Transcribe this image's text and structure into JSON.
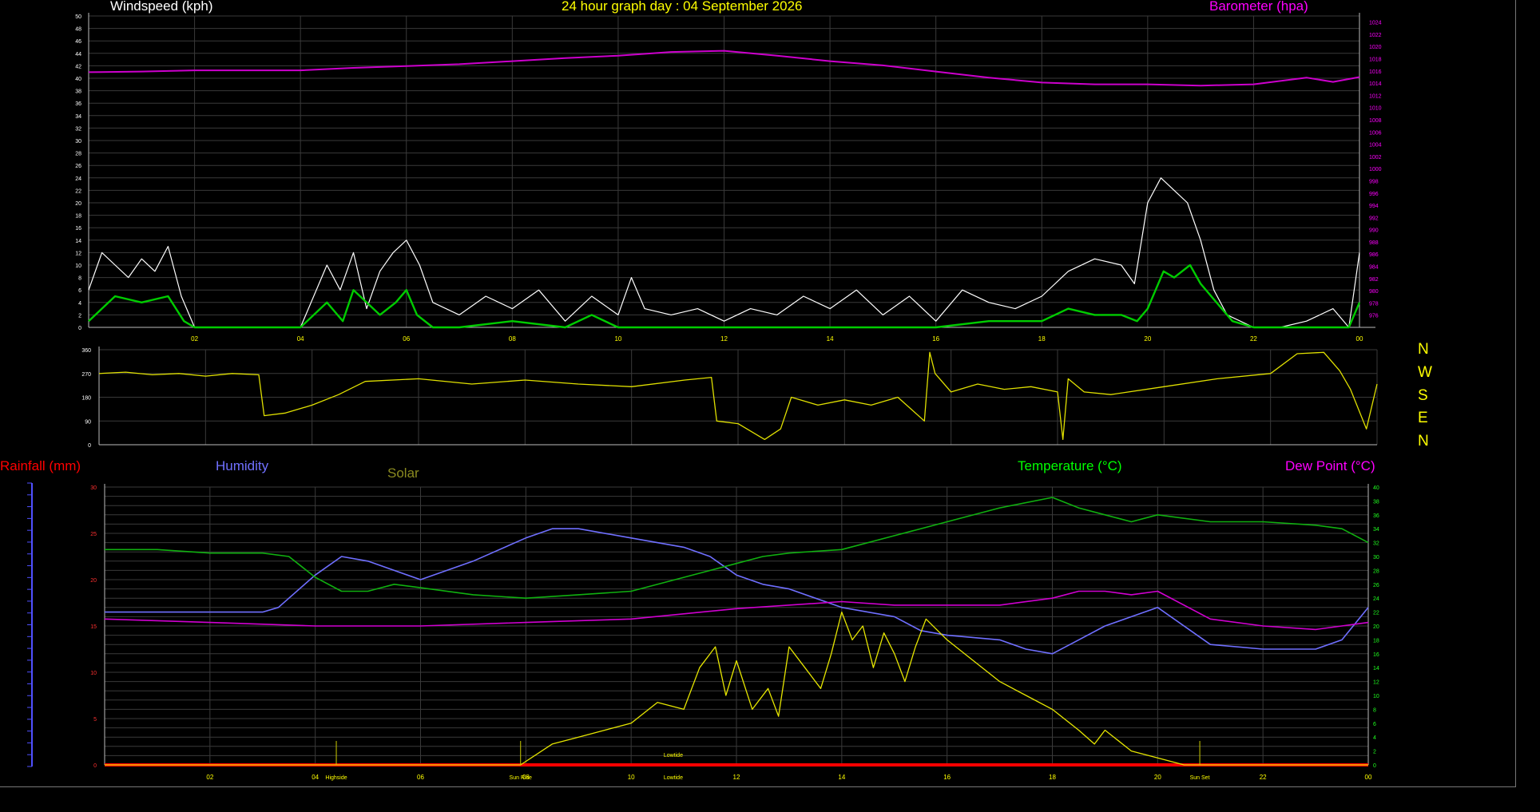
{
  "header": {
    "windspeed_title": "Windspeed (kph)",
    "main_title": "24 hour graph day : 04 September 2026",
    "barometer_title": "Barometer (hpa)"
  },
  "lower_header": {
    "rainfall_title": "Rainfall (mm)",
    "humidity_title": "Humidity",
    "solar_title": "Solar",
    "temperature_title": "Temperature (°C)",
    "dewpoint_title": "Dew Point (°C)"
  },
  "compass_labels": [
    "N",
    "W",
    "S",
    "E",
    "N"
  ],
  "colors": {
    "windspeed": "#ffffff",
    "wind_avg": "#00cc00",
    "barometer": "#cc00cc",
    "wind_direction": "#e0e000",
    "humidity": "#6f6fff",
    "temperature": "#10b010",
    "dewpoint": "#d000d0",
    "solar": "#e6e600",
    "rainfall": "#ff0000",
    "grid": "#3a3a3a"
  },
  "chart_data": [
    {
      "type": "line",
      "title": "24 hour graph day : 04 September 2026",
      "x_tick_labels": [
        "02",
        "04",
        "06",
        "08",
        "10",
        "12",
        "14",
        "16",
        "18",
        "20",
        "22",
        "00"
      ],
      "x_range_hours": [
        0.0,
        24.0
      ],
      "ylabel": "Windspeed (kph)",
      "ylim": [
        0,
        50
      ],
      "y_ticks": [
        0,
        2,
        4,
        6,
        8,
        10,
        12,
        14,
        16,
        18,
        20,
        22,
        24,
        26,
        28,
        30,
        32,
        34,
        36,
        38,
        40,
        42,
        44,
        46,
        48,
        50
      ],
      "y2label": "Barometer (hpa)",
      "y2lim": [
        974,
        1025
      ],
      "y2_ticks": [
        976,
        978,
        980,
        982,
        984,
        986,
        988,
        990,
        992,
        994,
        996,
        998,
        1000,
        1002,
        1004,
        1006,
        1008,
        1010,
        1012,
        1014,
        1016,
        1018,
        1020,
        1022,
        1024
      ],
      "series": [
        {
          "name": "Windspeed (kph)",
          "axis": "left",
          "x": [
            0.0,
            0.25,
            0.5,
            0.75,
            1.0,
            1.25,
            1.5,
            1.75,
            2.0,
            3.0,
            4.0,
            4.5,
            4.75,
            5.0,
            5.25,
            5.5,
            5.75,
            6.0,
            6.25,
            6.5,
            7.0,
            7.5,
            8.0,
            8.5,
            9.0,
            9.5,
            10.0,
            10.25,
            10.5,
            11.0,
            11.5,
            12.0,
            12.5,
            13.0,
            13.5,
            14.0,
            14.5,
            15.0,
            15.5,
            16.0,
            16.5,
            17.0,
            17.5,
            18.0,
            18.5,
            19.0,
            19.5,
            19.75,
            20.0,
            20.25,
            20.5,
            20.75,
            21.0,
            21.25,
            21.5,
            22.0,
            22.5,
            23.0,
            23.5,
            23.8,
            24.0
          ],
          "y": [
            6,
            12,
            10,
            8,
            11,
            9,
            13,
            5,
            0,
            0,
            0,
            10,
            6,
            12,
            3,
            9,
            12,
            14,
            10,
            4,
            2,
            5,
            3,
            6,
            1,
            5,
            2,
            8,
            3,
            2,
            3,
            1,
            3,
            2,
            5,
            3,
            6,
            2,
            5,
            1,
            6,
            4,
            3,
            5,
            9,
            11,
            10,
            7,
            20,
            24,
            22,
            20,
            14,
            6,
            2,
            0,
            0,
            1,
            3,
            0,
            12
          ]
        },
        {
          "name": "Windspeed average (kph)",
          "axis": "left",
          "x": [
            0.0,
            0.5,
            1.0,
            1.5,
            1.8,
            2.0,
            3.0,
            4.0,
            4.5,
            4.8,
            5.0,
            5.5,
            5.8,
            6.0,
            6.2,
            6.5,
            7.0,
            8.0,
            9.0,
            9.5,
            10.0,
            12.0,
            14.0,
            16.0,
            17.0,
            18.0,
            18.5,
            19.0,
            19.5,
            19.8,
            20.0,
            20.3,
            20.5,
            20.8,
            21.0,
            21.3,
            21.6,
            22.0,
            23.0,
            23.8,
            24.0
          ],
          "y": [
            1,
            5,
            4,
            5,
            1,
            0,
            0,
            0,
            4,
            1,
            6,
            2,
            4,
            6,
            2,
            0,
            0,
            1,
            0,
            2,
            0,
            0,
            0,
            0,
            1,
            1,
            3,
            2,
            2,
            1,
            3,
            9,
            8,
            10,
            7,
            4,
            1,
            0,
            0,
            0,
            4
          ]
        },
        {
          "name": "Barometer (hpa)",
          "axis": "right",
          "x": [
            0,
            1,
            2,
            3,
            4,
            5,
            6,
            7,
            8,
            9,
            10,
            11,
            12,
            13,
            14,
            15,
            16,
            17,
            18,
            19,
            20,
            21,
            22,
            23,
            23.5,
            24
          ],
          "y": [
            1015.8,
            1015.9,
            1016.1,
            1016.1,
            1016.1,
            1016.5,
            1016.8,
            1017.1,
            1017.6,
            1018.1,
            1018.5,
            1019.1,
            1019.3,
            1018.5,
            1017.6,
            1016.9,
            1015.9,
            1014.9,
            1014.1,
            1013.8,
            1013.8,
            1013.6,
            1013.8,
            1014.9,
            1014.2,
            1015.0
          ]
        }
      ]
    },
    {
      "type": "line",
      "x_range_hours": [
        0.0,
        24.0
      ],
      "ylim": [
        0,
        360
      ],
      "y_ticks": [
        0,
        90,
        180,
        270,
        360
      ],
      "y_labels_right": [
        "N",
        "W",
        "S",
        "E",
        "N"
      ],
      "series": [
        {
          "name": "Wind direction",
          "x": [
            0.0,
            0.5,
            1.0,
            1.5,
            2.0,
            2.5,
            3.0,
            3.1,
            3.5,
            4.0,
            4.5,
            5.0,
            6.0,
            7.0,
            8.0,
            9.0,
            10.0,
            11.0,
            11.5,
            11.6,
            12.0,
            12.5,
            12.8,
            13.0,
            13.5,
            14.0,
            14.5,
            15.0,
            15.5,
            15.6,
            15.7,
            16.0,
            16.5,
            17.0,
            17.5,
            18.0,
            18.1,
            18.2,
            18.5,
            19.0,
            20.0,
            21.0,
            22.0,
            22.5,
            23.0,
            23.3,
            23.5,
            23.8,
            24.0
          ],
          "y": [
            270,
            275,
            265,
            270,
            260,
            270,
            265,
            110,
            120,
            150,
            190,
            240,
            250,
            230,
            245,
            230,
            220,
            245,
            255,
            90,
            80,
            20,
            60,
            180,
            150,
            170,
            150,
            180,
            90,
            350,
            270,
            200,
            230,
            210,
            220,
            200,
            20,
            250,
            200,
            190,
            220,
            250,
            270,
            345,
            350,
            280,
            210,
            60,
            230
          ]
        }
      ]
    },
    {
      "type": "line",
      "x_tick_labels": [
        "02",
        "04",
        "06",
        "08",
        "10",
        "12",
        "14",
        "16",
        "18",
        "20",
        "22",
        "00"
      ],
      "x_range_hours": [
        0.0,
        24.0
      ],
      "annotations": [
        "Highside",
        "Sun Rise",
        "Lowtide",
        "Lowtide",
        "Sun Set"
      ],
      "ylabel": "Humidity",
      "ylim": [
        0,
        30
      ],
      "y_ticks": [
        0,
        5,
        10,
        15,
        20,
        25,
        30
      ],
      "y2label": "Temperature (°C)",
      "y2lim": [
        0,
        40
      ],
      "y2_ticks": [
        0,
        2,
        4,
        6,
        8,
        10,
        12,
        14,
        16,
        18,
        20,
        22,
        24,
        26,
        28,
        30,
        32,
        34,
        36,
        38,
        40
      ],
      "series": [
        {
          "name": "Humidity",
          "axis": "left",
          "x": [
            0,
            1,
            2,
            3,
            3.3,
            4.0,
            4.5,
            5.0,
            5.5,
            6.0,
            7.0,
            8.0,
            8.5,
            9.0,
            10.0,
            11.0,
            11.5,
            12.0,
            12.5,
            13.0,
            14.0,
            15.0,
            15.5,
            16.0,
            17.0,
            17.5,
            18.0,
            18.5,
            19.0,
            19.5,
            20.0,
            21.0,
            22.0,
            23.0,
            23.5,
            24.0
          ],
          "y": [
            16.5,
            16.5,
            16.5,
            16.5,
            17.0,
            20.5,
            22.5,
            22.0,
            21.0,
            20.0,
            22.0,
            24.5,
            25.5,
            25.5,
            24.5,
            23.5,
            22.5,
            20.5,
            19.5,
            19.0,
            17.0,
            16.0,
            14.5,
            14.0,
            13.5,
            12.5,
            12.0,
            13.5,
            15.0,
            16.0,
            17.0,
            13.0,
            12.5,
            12.5,
            13.5,
            17.0
          ]
        },
        {
          "name": "Temperature (°C)",
          "axis": "right",
          "x": [
            0,
            1,
            2,
            3,
            3.5,
            4.0,
            4.5,
            5.0,
            5.5,
            6.0,
            7.0,
            8.0,
            9.0,
            10.0,
            11.0,
            12.0,
            12.5,
            13.0,
            14.0,
            15.0,
            16.0,
            17.0,
            18.0,
            18.5,
            19.0,
            19.5,
            20.0,
            21.0,
            22.0,
            23.0,
            23.5,
            24.0
          ],
          "y": [
            31,
            31,
            30.5,
            30.5,
            30,
            27,
            25,
            25,
            26,
            25.5,
            24.5,
            24,
            24.5,
            25,
            27,
            29,
            30,
            30.5,
            31,
            33,
            35,
            37,
            38.5,
            37,
            36,
            35,
            36,
            35,
            35,
            34.5,
            34,
            32
          ]
        },
        {
          "name": "Dew Point (°C)",
          "axis": "right",
          "x": [
            0,
            2,
            4,
            6,
            8,
            10,
            12,
            14,
            15,
            16,
            17,
            18,
            18.5,
            19,
            19.5,
            20,
            21,
            22,
            23,
            24
          ],
          "y": [
            21,
            20.5,
            20,
            20,
            20.5,
            21,
            22.5,
            23.5,
            23,
            23,
            23,
            24,
            25,
            25,
            24.5,
            25,
            21,
            20,
            19.5,
            20.5
          ]
        },
        {
          "name": "Solar",
          "axis": "right",
          "x": [
            0,
            6,
            7.9,
            8.5,
            9.0,
            9.5,
            10.0,
            10.5,
            11.0,
            11.3,
            11.6,
            11.8,
            12.0,
            12.3,
            12.6,
            12.8,
            13.0,
            13.3,
            13.6,
            13.8,
            14.0,
            14.2,
            14.4,
            14.6,
            14.8,
            15.0,
            15.2,
            15.4,
            15.6,
            16.0,
            16.5,
            17.0,
            17.5,
            18.0,
            18.5,
            18.8,
            19.0,
            19.5,
            20.0,
            20.5,
            24.0
          ],
          "y": [
            0,
            0,
            0,
            3,
            4,
            5,
            6,
            9,
            8,
            14,
            17,
            10,
            15,
            8,
            11,
            7,
            17,
            14,
            11,
            16,
            22,
            18,
            20,
            14,
            19,
            16,
            12,
            17,
            21,
            18,
            15,
            12,
            10,
            8,
            5,
            3,
            5,
            2,
            1,
            0,
            0
          ]
        },
        {
          "name": "Rainfall (mm)",
          "axis": "left",
          "x": [
            0,
            24
          ],
          "y": [
            0,
            0
          ]
        }
      ]
    }
  ]
}
